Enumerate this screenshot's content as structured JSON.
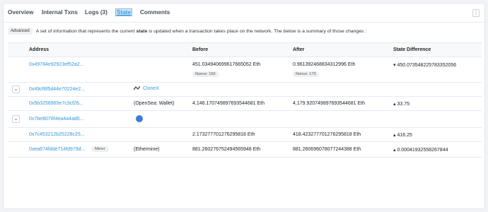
{
  "tabs": [
    {
      "label": "Overview"
    },
    {
      "label": "Internal Txns"
    },
    {
      "label": "Logs (3)"
    },
    {
      "label": "State"
    },
    {
      "label": "Comments"
    }
  ],
  "menu_glyph": "⋮",
  "description": {
    "badge": "Advanced",
    "prefix": "A set of information that represents the current",
    "bold": "state",
    "suffix": "is updated when a transaction takes place on the network. The below is a summary of those changes :"
  },
  "columns": {
    "address": "Address",
    "before": "Before",
    "after": "After",
    "diff": "State Difference"
  },
  "rows": [
    {
      "address": "0x49784e92923ef52a2...",
      "before": "451.034940699617665052 Eth",
      "before_nonce": "Nonce: 169",
      "after": "0.961392468834312996 Eth",
      "after_nonce": "Nonce: 170",
      "diff": "▾ 450.073548225783352056"
    },
    {
      "toggle": "⌄",
      "address": "0x49cf6f5d44e70224e2...",
      "tag": "CloneX"
    },
    {
      "address": "0x5b3256965e7c3cf26...",
      "label": "(OpenSea: Wallet)",
      "before": "4,146.170749897693544681 Eth",
      "after": "4,179.920749897693544681 Eth",
      "diff": "▴ 33.75"
    },
    {
      "toggle": "⌄",
      "address": "0x7be8076f4ea4a4ad0..."
    },
    {
      "address": "0x7c453212b25228c25...",
      "before": "2.173277701276295818 Eth",
      "after": "418.423277701276295818 Eth",
      "diff": "▴ 416.25"
    },
    {
      "address": "0xea674fdde714fd979d...",
      "badge": "Miner",
      "label": "(Ethermine)",
      "before": "881.260276752494565948 Eth",
      "after": "881.260696078077244388 Eth",
      "diff": "▴ 0.00041932558267844"
    }
  ]
}
